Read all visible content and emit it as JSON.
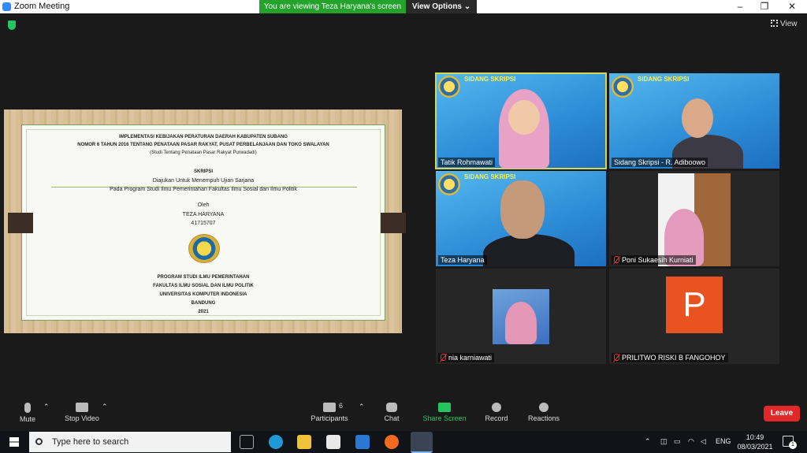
{
  "window": {
    "title": "Zoom Meeting",
    "banner_text": "You are viewing Teza Haryana's screen",
    "view_options_label": "View Options",
    "minimize": "–",
    "maximize": "❐",
    "close": "✕"
  },
  "view_button": {
    "label": "View"
  },
  "slide": {
    "line1": "IMPLEMENTASI KEBIJAKAN PERATURAN DAERAH KABUPATEN SUBANG",
    "line2": "NOMOR 6 TAHUN 2016 TENTANG PENATAAN PASAR RAKYAT, PUSAT PERBELANJAAN DAN TOKO SWALAYAN",
    "line3": "(Studi Tentang Penataan Pasar Rakyat Purwadadi)",
    "skripsi": "SKRIPSI",
    "purpose1": "Diajukan Untuk Menempuh Ujian Sarjana",
    "purpose2": "Pada Program Studi Ilmu Pemerintahan Fakultas Ilmu Sosial dan Ilmu Politik",
    "oleh": "Oleh",
    "author": "TEZA HARYANA",
    "nim": "41715707",
    "prodi": "PROGRAM STUDI ILMU PEMERINTAHAN",
    "fakultas": "FAKULTAS ILMU SOSIAL DAN ILMU POLITIK",
    "universitas": "UNIVERSITAS KOMPUTER INDONESIA",
    "kota": "BANDUNG",
    "tahun": "2021"
  },
  "participants_tiles": [
    {
      "name": "Tatik Rohmawati",
      "header": "SIDANG SKRIPSI",
      "muted": false
    },
    {
      "name": "Sidang Skripsi - R. Adiboowo",
      "header": "SIDANG SKRIPSI",
      "muted": false
    },
    {
      "name": "Teza Haryana",
      "header": "SIDANG SKRIPSI",
      "muted": false
    },
    {
      "name": "Poni Sukaesih Kurniati",
      "muted": true
    },
    {
      "name": "nia karniawati",
      "muted": true
    },
    {
      "name": "PRILITWO RISKI B FANGOHOY",
      "muted": true,
      "avatar_letter": "P"
    }
  ],
  "toolbar": {
    "mute": "Mute",
    "stop_video": "Stop Video",
    "participants": "Participants",
    "participants_count": "6",
    "chat": "Chat",
    "share_screen": "Share Screen",
    "record": "Record",
    "reactions": "Reactions",
    "leave": "Leave"
  },
  "taskbar": {
    "search_placeholder": "Type here to search",
    "language": "ENG",
    "time": "10:49",
    "date": "08/03/2021",
    "notification_count": "1"
  },
  "colors": {
    "banner_green": "#23a32c",
    "leave_red": "#e02828",
    "share_green": "#22c55e",
    "avatar_orange": "#e8531f",
    "active_speaker_outline": "#d4d65a"
  }
}
